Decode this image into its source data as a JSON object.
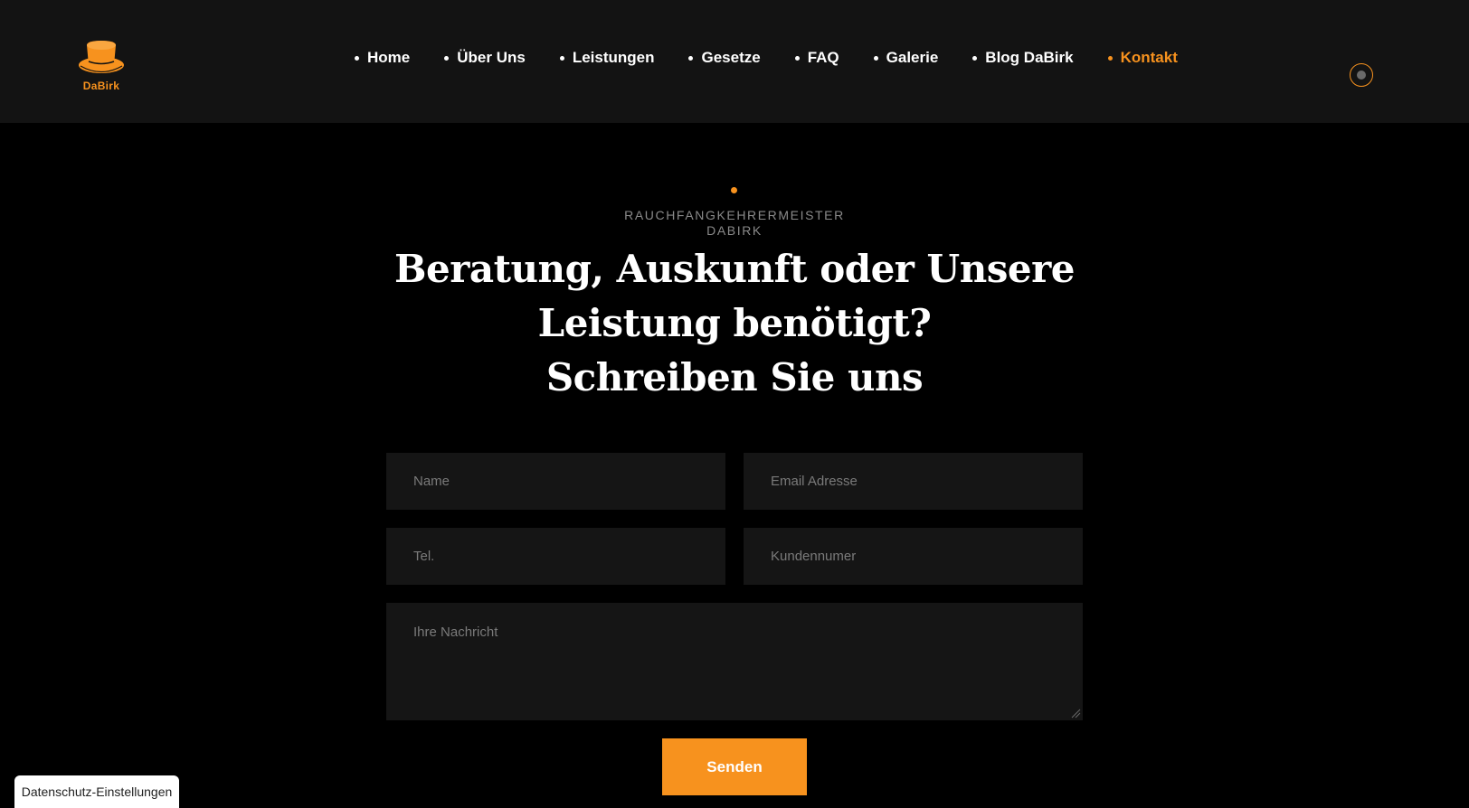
{
  "brand": {
    "name": "DaBirk",
    "accent_color": "#f7921e",
    "logo_icon": "top-hat-icon"
  },
  "nav": {
    "items": [
      {
        "label": "Home",
        "active": false
      },
      {
        "label": "Über Uns",
        "active": false
      },
      {
        "label": "Leistungen",
        "active": false
      },
      {
        "label": "Gesetze",
        "active": false
      },
      {
        "label": "FAQ",
        "active": false
      },
      {
        "label": "Galerie",
        "active": false
      },
      {
        "label": "Blog DaBirk",
        "active": false
      },
      {
        "label": "Kontakt",
        "active": true
      }
    ]
  },
  "header_button": {
    "icon": "circle-toggle-icon"
  },
  "hero": {
    "eyebrow_line1": "RAUCHFANGKEHRERMEISTER",
    "eyebrow_line2": "DABIRK",
    "heading_line1": "Beratung, Auskunft oder Unsere",
    "heading_line2": "Leistung benötigt?",
    "heading_line3": "Schreiben Sie uns"
  },
  "form": {
    "name_placeholder": "Name",
    "email_placeholder": "Email Adresse",
    "tel_placeholder": "Tel.",
    "kunde_placeholder": "Kundennumer",
    "message_placeholder": "Ihre Nachricht",
    "submit_label": "Senden"
  },
  "privacy": {
    "label": "Datenschutz-Einstellungen"
  }
}
